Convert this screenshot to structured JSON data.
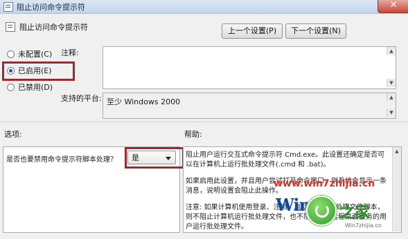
{
  "window": {
    "title": "阻止访问命令提示符",
    "close_glyph": "✕"
  },
  "header": {
    "title": "阻止访问命令提示符",
    "prev_button": "上一个设置(P)",
    "next_button": "下一个设置(N)"
  },
  "state_options": [
    {
      "label": "未配置(C)",
      "checked": false
    },
    {
      "label": "已启用(E)",
      "checked": true
    },
    {
      "label": "已禁用(D)",
      "checked": false
    }
  ],
  "comment": {
    "label": "注释:",
    "value": ""
  },
  "platform": {
    "label": "支持的平台:",
    "value": "至少 Windows 2000"
  },
  "options": {
    "section_label": "选项:",
    "question": "是否也要禁用命令提示符脚本处理？",
    "selected": "是"
  },
  "help": {
    "section_label": "帮助:",
    "paragraphs": [
      "阻止用户运行交互式命令提示符 Cmd.exe。此设置还确定是否可以在计算机上运行批处理文件(.cmd 和 .bat)。",
      "如果启用此设置，并且用户尝试打开命令窗口，则系统会显示一条消息，说明设置会阻止此操作。",
      "注意: 如果计算机使用登录、注销、启动或关机批处理文件脚本，则不阻止计算机运行批处理文件，也不阻止使用远程桌面服务的用户运行批处理文件。"
    ]
  },
  "watermark": {
    "url_text": "www.win7zhijia.cn",
    "logo_text": "Win7",
    "logo_text2": "之家",
    "logo_small": "Win7zhijia.cn"
  },
  "colors": {
    "highlight": "#a0282a",
    "close_button": "#c9463a",
    "radio_dot": "#1f4fae"
  }
}
